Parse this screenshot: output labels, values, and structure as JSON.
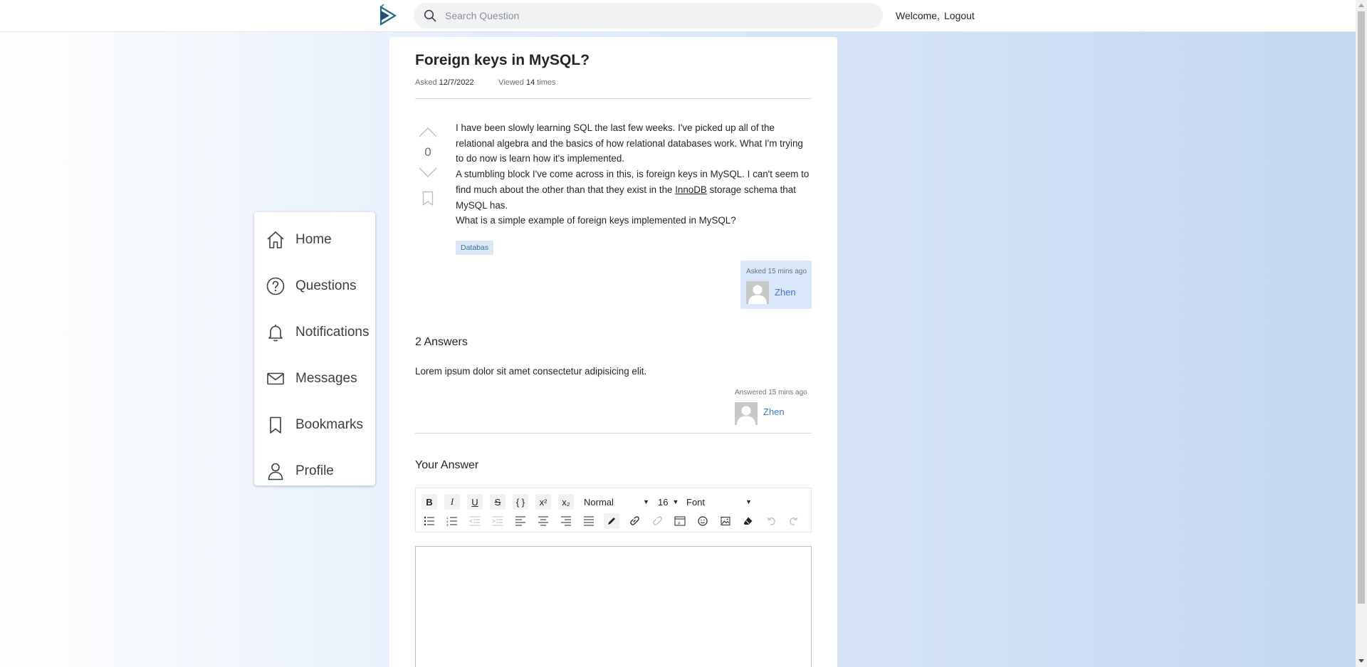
{
  "header": {
    "search_placeholder": "Search Question",
    "welcome": "Welcome,",
    "logout": "Logout"
  },
  "sidebar": {
    "items": [
      {
        "label": "Home",
        "icon": "home-icon"
      },
      {
        "label": "Questions",
        "icon": "question-circle-icon"
      },
      {
        "label": "Notifications",
        "icon": "bell-icon"
      },
      {
        "label": "Messages",
        "icon": "envelope-icon"
      },
      {
        "label": "Bookmarks",
        "icon": "bookmark-icon"
      },
      {
        "label": "Profile",
        "icon": "person-icon"
      }
    ]
  },
  "question": {
    "title": "Foreign keys in MySQL?",
    "asked_label": "Asked",
    "asked_date": "12/7/2022",
    "viewed_label": "Viewed",
    "viewed_count": "14",
    "viewed_suffix": "times",
    "votes": "0",
    "body": {
      "p1": "I have been slowly learning SQL the last few weeks. I've picked up all of the relational algebra and the basics of how relational databases work. What I'm trying to do now is learn how it's implemented.",
      "p2_before": "A stumbling block I've come across in this, is foreign keys in MySQL. I can't seem to find much about the other than that they exist in the ",
      "p2_link": "InnoDB",
      "p2_after": " storage schema that MySQL has.",
      "p3": "What is a simple example of foreign keys implemented in MySQL?"
    },
    "tag": "Databas",
    "asked_ago": "Asked 15 mins ago",
    "author": "Zhen"
  },
  "answers": {
    "count_label": "2 Answers",
    "items": [
      {
        "text": "Lorem ipsum dolor sit amet consectetur adipisicing elit.",
        "answered_ago": "Answered 15 mins ago",
        "author": "Zhen"
      }
    ]
  },
  "your_answer": {
    "heading": "Your Answer",
    "toolbar": {
      "bold": "B",
      "italic": "I",
      "underline": "U",
      "strike": "S",
      "code": "{ }",
      "superscript": "x²",
      "subscript": "x₂",
      "block_format": "Normal",
      "font_size": "16",
      "font_name": "Font"
    }
  },
  "colors": {
    "link": "#3f78d8",
    "tag_bg": "#d9e7f7",
    "asked_card_bg": "#d9e7fa"
  }
}
